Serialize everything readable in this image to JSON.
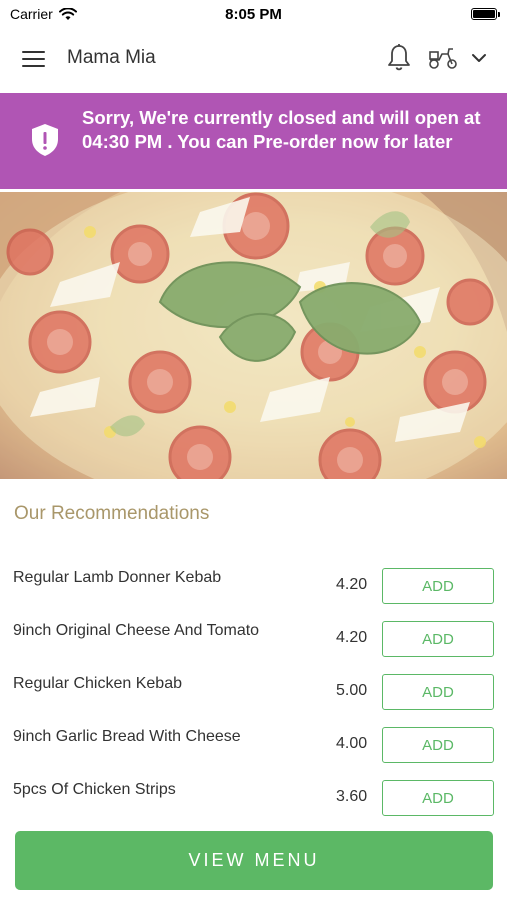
{
  "status_bar": {
    "carrier": "Carrier",
    "time": "8:05 PM"
  },
  "header": {
    "title": "Mama Mia"
  },
  "notice": {
    "message": "Sorry, We're currently closed and will open at 04:30 PM . You can Pre-order now for later",
    "color": "#b055b4"
  },
  "recommendations": {
    "title": "Our Recommendations",
    "items": [
      {
        "name": "Regular Lamb Donner Kebab",
        "price": "4.20",
        "button": "ADD"
      },
      {
        "name": "9inch Original Cheese And Tomato",
        "price": "4.20",
        "button": "ADD"
      },
      {
        "name": "Regular Chicken Kebab",
        "price": "5.00",
        "button": "ADD"
      },
      {
        "name": "9inch Garlic Bread With Cheese",
        "price": "4.00",
        "button": "ADD"
      },
      {
        "name": "5pcs Of Chicken Strips",
        "price": "3.60",
        "button": "ADD"
      }
    ]
  },
  "footer": {
    "view_menu_label": "VIEW MENU",
    "accent": "#5cb865"
  }
}
